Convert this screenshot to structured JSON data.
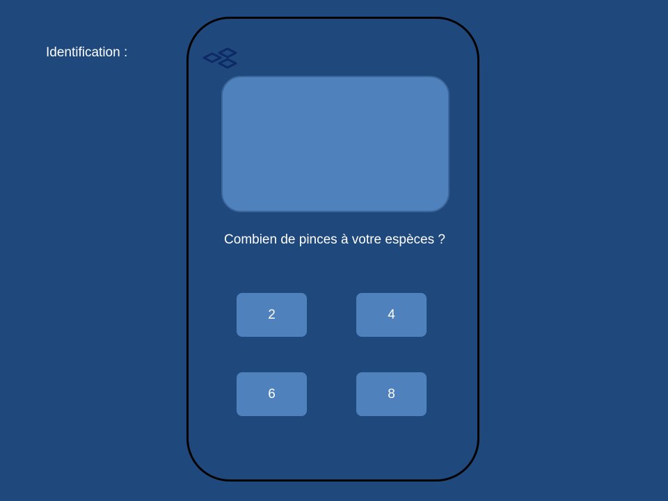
{
  "page": {
    "label": "Identification :"
  },
  "phone": {
    "logo_icon": "diamond-cluster-icon",
    "question": "Combien de pinces à votre espèces ?",
    "answers": [
      "2",
      "4",
      "6",
      "8"
    ]
  },
  "colors": {
    "background": "#1f487c",
    "accent": "#4f81bd",
    "outline": "#000000",
    "logo": "#0d2a66"
  }
}
